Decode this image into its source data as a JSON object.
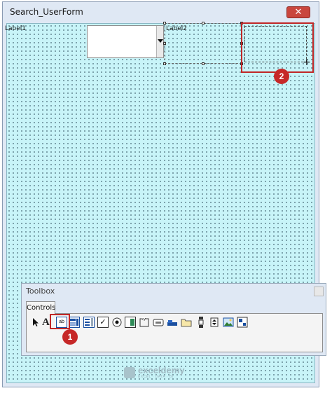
{
  "window": {
    "title": "Search_UserForm",
    "close_glyph": "✕"
  },
  "form": {
    "label1": "Label1",
    "label2": "Label2"
  },
  "annotations": {
    "step1": "1",
    "step2": "2"
  },
  "toolbox": {
    "title": "Toolbox",
    "tab": "Controls",
    "tools": [
      {
        "icon": "select-objects-icon"
      },
      {
        "icon": "label-icon",
        "glyph": "A"
      },
      {
        "icon": "textbox-icon",
        "glyph": "ab"
      },
      {
        "icon": "combobox-icon"
      },
      {
        "icon": "listbox-icon"
      },
      {
        "icon": "checkbox-icon",
        "glyph": "✓"
      },
      {
        "icon": "optionbutton-icon"
      },
      {
        "icon": "togglebutton-icon"
      },
      {
        "icon": "frame-icon"
      },
      {
        "icon": "commandbutton-icon"
      },
      {
        "icon": "tabstrip-icon"
      },
      {
        "icon": "multipage-icon"
      },
      {
        "icon": "scrollbar-icon"
      },
      {
        "icon": "spinbutton-icon"
      },
      {
        "icon": "image-icon"
      },
      {
        "icon": "refedit-icon"
      }
    ]
  },
  "watermark": {
    "name": "exceldemy",
    "tagline": "EXCEL · DATA · BI"
  },
  "colors": {
    "canvas": "#c8f4f8",
    "highlight": "#c02727",
    "close": "#c9463d"
  }
}
